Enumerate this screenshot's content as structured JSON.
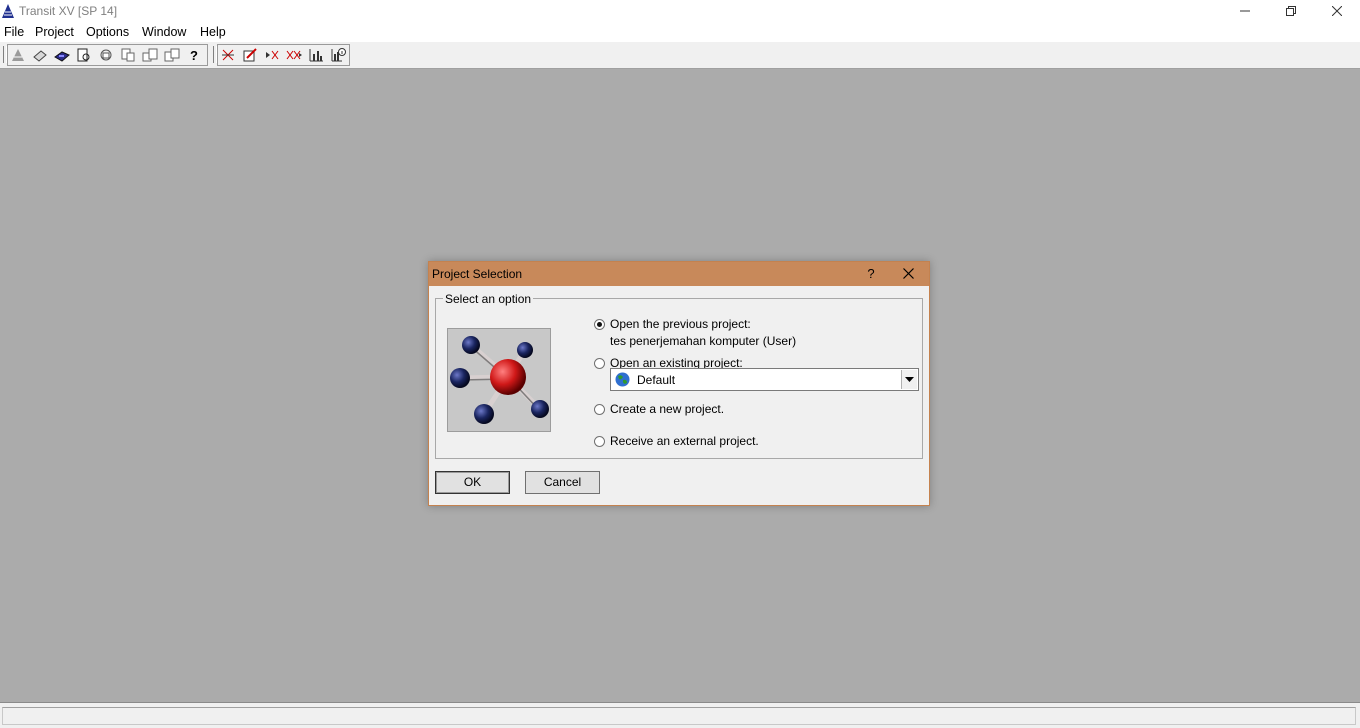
{
  "window": {
    "title": "Transit XV [SP 14]",
    "icon": "transit-logo-icon"
  },
  "menu": [
    "File",
    "Project",
    "Options",
    "Window",
    "Help"
  ],
  "toolbar": {
    "group1": [
      "triangle-icon",
      "eraser-icon",
      "disk-icon",
      "view-icon",
      "rotate-icon",
      "copy-icon",
      "copy2-icon",
      "copy3-icon",
      "help-icon"
    ],
    "group2": [
      "flow-icon",
      "edit-icon",
      "step-forward-icon",
      "step-double-icon",
      "bar-chart-icon",
      "bar-chart-info-icon"
    ]
  },
  "dialog": {
    "title": "Project Selection",
    "help": "?",
    "group_label": "Select an option",
    "options": {
      "previous": {
        "label": "Open the previous project:",
        "sub": "tes penerjemahan komputer (User)",
        "checked": true
      },
      "existing": {
        "label": "Open an existing project:",
        "checked": false
      },
      "new": {
        "label": "Create a new project.",
        "checked": false
      },
      "external": {
        "label": "Receive an external project.",
        "checked": false
      }
    },
    "project_dropdown": {
      "value": "Default",
      "icon": "globe-icon"
    },
    "ok_label": "OK",
    "cancel_label": "Cancel"
  },
  "colors": {
    "dialog_title": "#c8895a",
    "workspace": "#ababab"
  }
}
